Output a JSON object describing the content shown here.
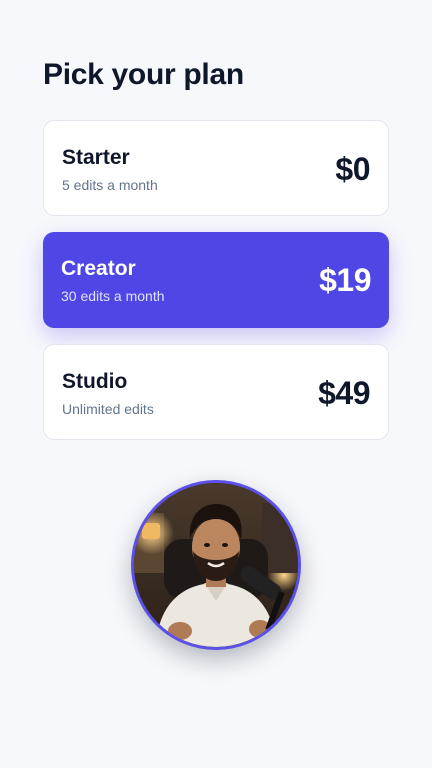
{
  "header": {
    "title": "Pick your plan"
  },
  "plans": [
    {
      "name": "Starter",
      "description": "5 edits a month",
      "price": "$0",
      "selected": false
    },
    {
      "name": "Creator",
      "description": "30 edits a month",
      "price": "$19",
      "selected": true
    },
    {
      "name": "Studio",
      "description": "Unlimited edits",
      "price": "$49",
      "selected": false
    }
  ],
  "colors": {
    "accent": "#4f46e5",
    "background": "#f7f8fc",
    "card": "#ffffff",
    "title_text": "#0f172a",
    "muted_text": "#64748b"
  },
  "avatar": {
    "icon": "presenter-avatar"
  }
}
